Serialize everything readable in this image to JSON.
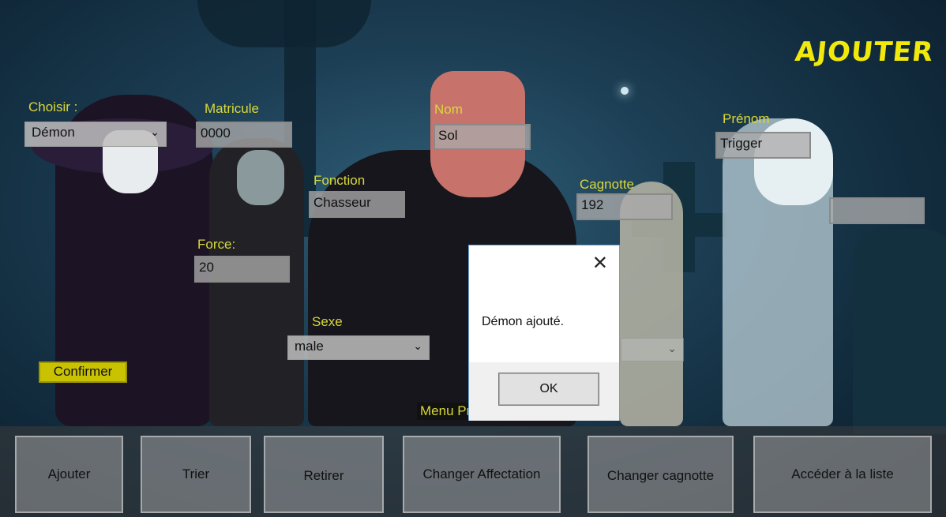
{
  "title": "AJOUTER",
  "choisir": {
    "label": "Choisir :",
    "value": "Démon"
  },
  "matricule": {
    "label": "Matricule",
    "value": "0000"
  },
  "nom": {
    "label": "Nom",
    "value": "Sol"
  },
  "prenom": {
    "label": "Prénom",
    "value": "Trigger"
  },
  "fonction": {
    "label": "Fonction",
    "value": "Chasseur"
  },
  "cagnotte": {
    "label": "Cagnotte",
    "value": "192"
  },
  "force": {
    "label": "Force:",
    "value": "20"
  },
  "sexe": {
    "label": "Sexe",
    "value": "male"
  },
  "confirm_label": "Confirmer",
  "menu_label": "Menu Pr",
  "nav": [
    "Ajouter",
    "Trier",
    "Retirer",
    "Changer Affectation",
    "Changer cagnotte",
    "Accéder à la liste"
  ],
  "dialog": {
    "message": "Démon ajouté.",
    "ok_label": "OK",
    "close_icon": "close-icon"
  },
  "colors": {
    "label_yellow": "#d8d83a",
    "title_yellow": "#f2e90c",
    "confirm_bg": "#c9c200"
  }
}
